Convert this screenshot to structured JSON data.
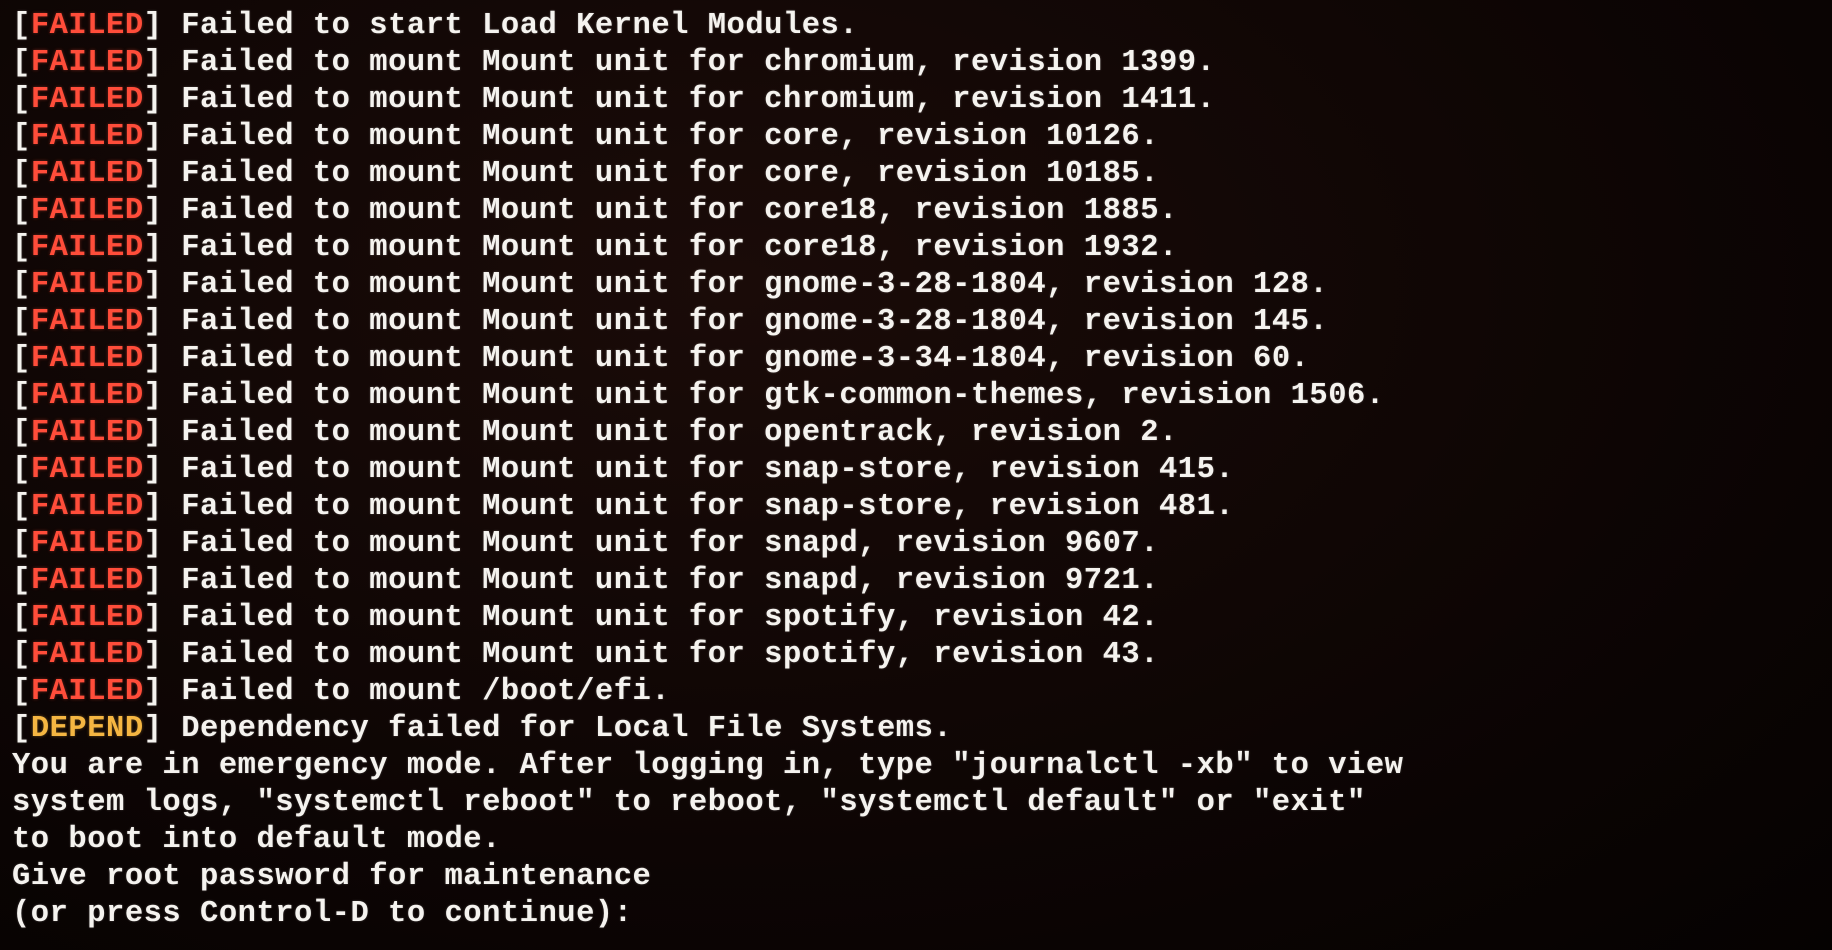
{
  "colors": {
    "failed": "#ff4d3a",
    "depend": "#f5b642",
    "text": "#f5f3ef",
    "background": "#0d0504"
  },
  "status_lines": [
    {
      "status": "FAILED",
      "message": "Failed to start Load Kernel Modules."
    },
    {
      "status": "FAILED",
      "message": "Failed to mount Mount unit for chromium, revision 1399."
    },
    {
      "status": "FAILED",
      "message": "Failed to mount Mount unit for chromium, revision 1411."
    },
    {
      "status": "FAILED",
      "message": "Failed to mount Mount unit for core, revision 10126."
    },
    {
      "status": "FAILED",
      "message": "Failed to mount Mount unit for core, revision 10185."
    },
    {
      "status": "FAILED",
      "message": "Failed to mount Mount unit for core18, revision 1885."
    },
    {
      "status": "FAILED",
      "message": "Failed to mount Mount unit for core18, revision 1932."
    },
    {
      "status": "FAILED",
      "message": "Failed to mount Mount unit for gnome-3-28-1804, revision 128."
    },
    {
      "status": "FAILED",
      "message": "Failed to mount Mount unit for gnome-3-28-1804, revision 145."
    },
    {
      "status": "FAILED",
      "message": "Failed to mount Mount unit for gnome-3-34-1804, revision 60."
    },
    {
      "status": "FAILED",
      "message": "Failed to mount Mount unit for gtk-common-themes, revision 1506."
    },
    {
      "status": "FAILED",
      "message": "Failed to mount Mount unit for opentrack, revision 2."
    },
    {
      "status": "FAILED",
      "message": "Failed to mount Mount unit for snap-store, revision 415."
    },
    {
      "status": "FAILED",
      "message": "Failed to mount Mount unit for snap-store, revision 481."
    },
    {
      "status": "FAILED",
      "message": "Failed to mount Mount unit for snapd, revision 9607."
    },
    {
      "status": "FAILED",
      "message": "Failed to mount Mount unit for snapd, revision 9721."
    },
    {
      "status": "FAILED",
      "message": "Failed to mount Mount unit for spotify, revision 42."
    },
    {
      "status": "FAILED",
      "message": "Failed to mount Mount unit for spotify, revision 43."
    },
    {
      "status": "FAILED",
      "message": "Failed to mount /boot/efi."
    },
    {
      "status": "DEPEND",
      "message": "Dependency failed for Local File Systems."
    }
  ],
  "trailing_lines": [
    "You are in emergency mode. After logging in, type \"journalctl -xb\" to view",
    "system logs, \"systemctl reboot\" to reboot, \"systemctl default\" or \"exit\"",
    "to boot into default mode.",
    "Give root password for maintenance",
    "(or press Control-D to continue):"
  ],
  "brackets": {
    "open": "[",
    "close": "] "
  }
}
